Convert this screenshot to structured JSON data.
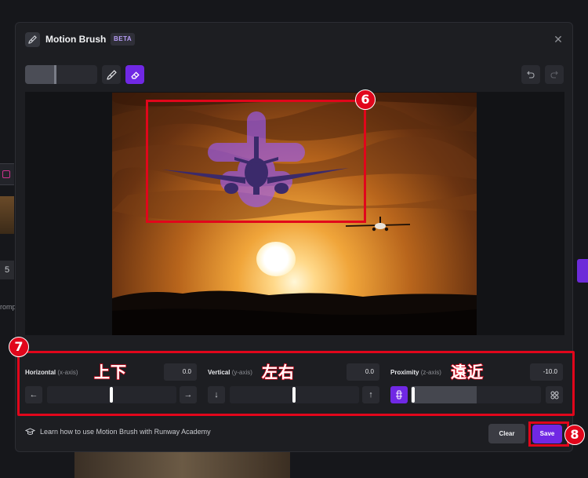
{
  "modal": {
    "title": "Motion Brush",
    "badge": "BETA",
    "close_icon": "close-icon"
  },
  "toolbar": {
    "brush_size_level": 0.43,
    "tools": [
      "brush-icon",
      "eraser-icon"
    ],
    "active_tool": "eraser",
    "undo_icon": "undo-icon",
    "redo_icon": "redo-icon"
  },
  "annotations": {
    "step6": "6",
    "step7": "7",
    "step8": "8",
    "horizontal_note": "上下",
    "vertical_note": "左右",
    "proximity_note": "遠近"
  },
  "controls": {
    "horizontal": {
      "label": "Horizontal",
      "axis": "(x-axis)",
      "value": "0.0",
      "left_icon": "←",
      "right_icon": "→",
      "level": 0.5
    },
    "vertical": {
      "label": "Vertical",
      "axis": "(y-axis)",
      "value": "0.0",
      "left_icon": "↓",
      "right_icon": "↑",
      "level": 0.5
    },
    "proximity": {
      "label": "Proximity",
      "axis": "(z-axis)",
      "value": "-10.0",
      "left_icon": "far-icon",
      "right_icon": "grid-icon",
      "level": 0.5
    }
  },
  "footer": {
    "academy_link": "Learn how to use Motion Brush with Runway Academy",
    "clear_label": "Clear",
    "save_label": "Save"
  },
  "background": {
    "number_tab": "5",
    "partial_text": "romp"
  },
  "colors": {
    "accent": "#7028e4",
    "annotation_red": "#e1061b",
    "brush_overlay": "#9a5cff"
  }
}
